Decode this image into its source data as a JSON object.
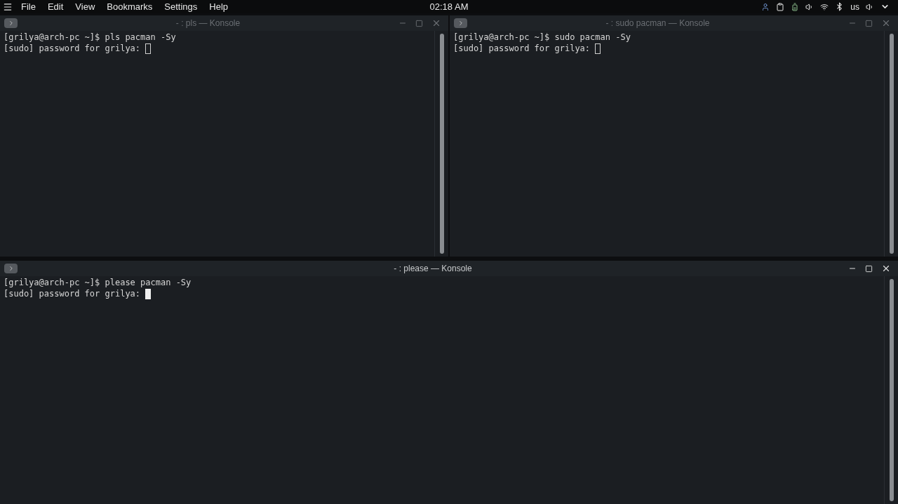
{
  "top_bar": {
    "menu_items": [
      "File",
      "Edit",
      "View",
      "Bookmarks",
      "Settings",
      "Help"
    ],
    "clock": "02:18 AM",
    "keyboard_layout": "us"
  },
  "windows": [
    {
      "title": "- : pls — Konsole",
      "active": false,
      "lines": [
        "[grilya@arch-pc ~]$ pls pacman -Sy",
        "[sudo] password for grilya:"
      ]
    },
    {
      "title": "- : sudo pacman — Konsole",
      "active": false,
      "lines": [
        "[grilya@arch-pc ~]$ sudo pacman -Sy",
        "[sudo] password for grilya:"
      ]
    },
    {
      "title": "- : please — Konsole",
      "active": true,
      "lines": [
        "[grilya@arch-pc ~]$ please pacman -Sy",
        "[sudo] password for grilya:"
      ]
    }
  ]
}
